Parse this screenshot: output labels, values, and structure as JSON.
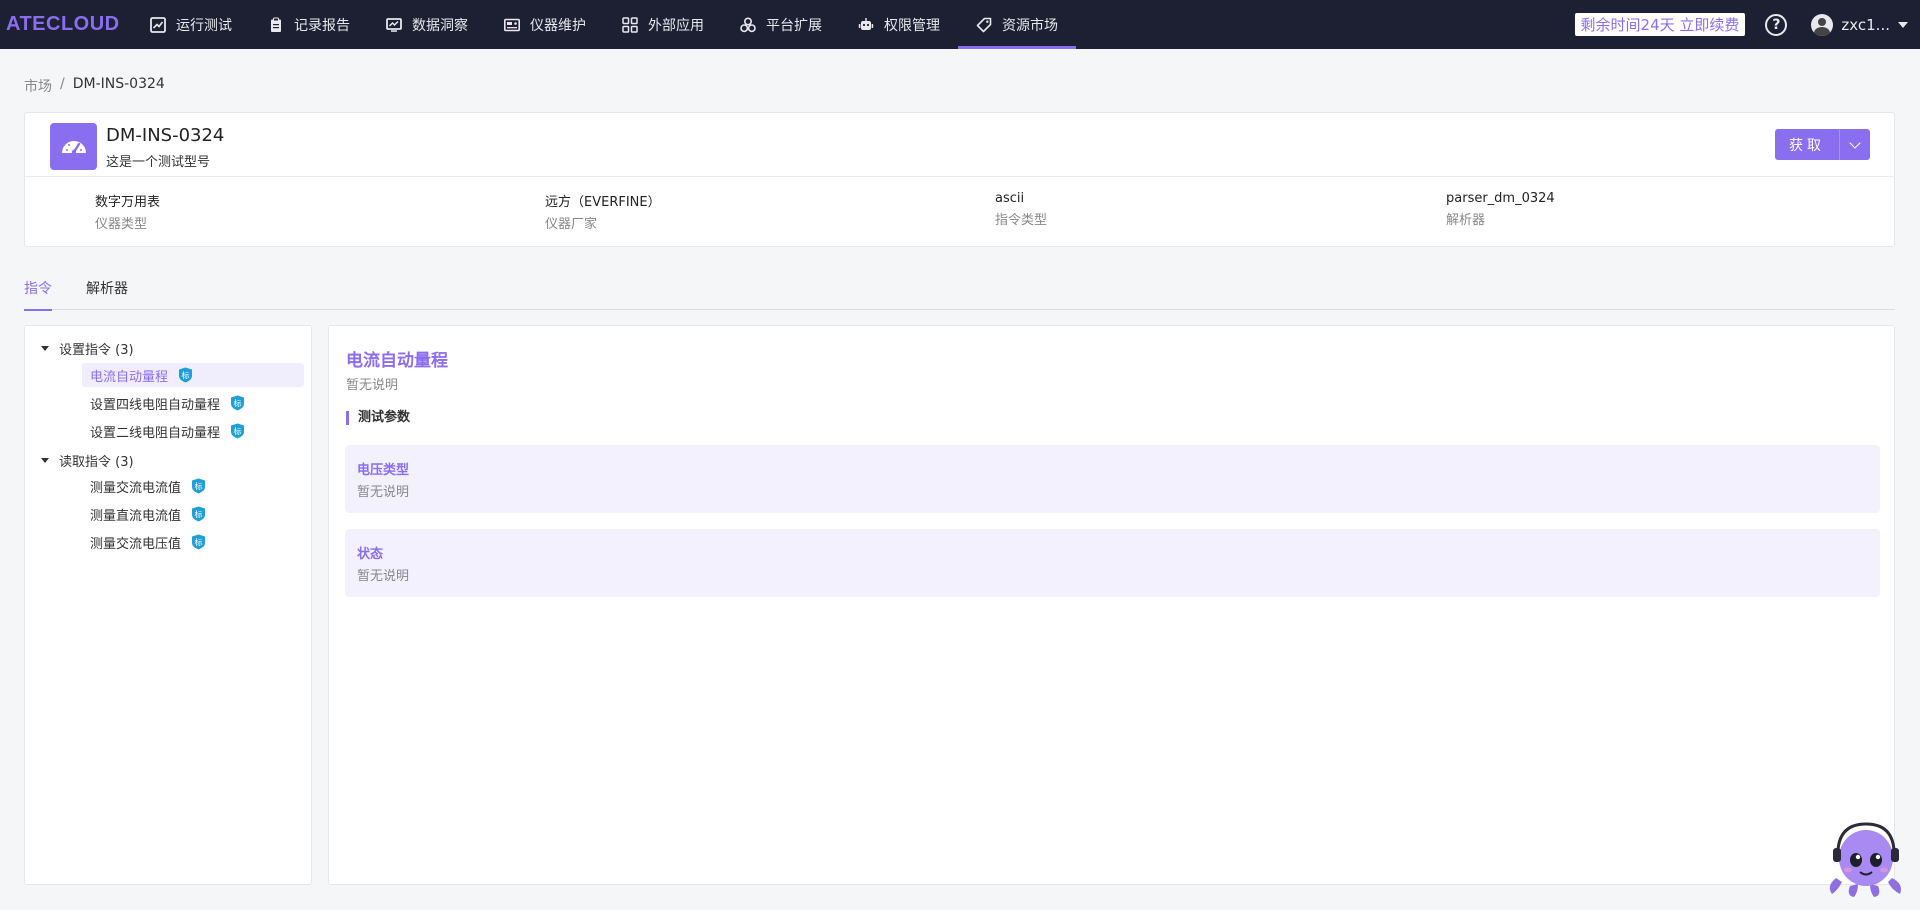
{
  "brand": {
    "logo": "ATECLOUD",
    "accent": "#8a6ef0",
    "nav_bg": "#1d1f33"
  },
  "nav": [
    {
      "label": "运行测试",
      "icon": "chart-line-icon"
    },
    {
      "label": "记录报告",
      "icon": "clipboard-icon"
    },
    {
      "label": "数据洞察",
      "icon": "monitor-icon"
    },
    {
      "label": "仪器维护",
      "icon": "instrument-icon"
    },
    {
      "label": "外部应用",
      "icon": "grid-apps-icon"
    },
    {
      "label": "平台扩展",
      "icon": "cluster-icon"
    },
    {
      "label": "权限管理",
      "icon": "robot-icon"
    },
    {
      "label": "资源市场",
      "icon": "tag-icon",
      "active": true
    }
  ],
  "topright": {
    "renew": "剩余时间24天 立即续费",
    "help": "?",
    "user": "zxc1..."
  },
  "breadcrumb": {
    "root": "市场",
    "sep": "/",
    "current": "DM-INS-0324"
  },
  "instrument": {
    "name": "DM-INS-0324",
    "subtitle": "这是一个测试型号",
    "get_button": "获取",
    "fields": [
      {
        "value": "数字万用表",
        "key": "仪器类型"
      },
      {
        "value": "远方（EVERFINE）",
        "key": "仪器厂家"
      },
      {
        "value": "ascii",
        "key": "指令类型"
      },
      {
        "value": "parser_dm_0324",
        "key": "解析器"
      }
    ]
  },
  "tabs": [
    {
      "label": "指令",
      "active": true
    },
    {
      "label": "解析器"
    }
  ],
  "tree": {
    "groups": [
      {
        "label": "设置指令 (3)",
        "items": [
          "电流自动量程",
          "设置四线电阻自动量程",
          "设置二线电阻自动量程"
        ]
      },
      {
        "label": "读取指令 (3)",
        "items": [
          "测量交流电流值",
          "测量直流电流值",
          "测量交流电压值"
        ]
      }
    ],
    "badge_text": "标",
    "badge_color": "#1e9fd8"
  },
  "detail": {
    "title": "电流自动量程",
    "desc": "暂无说明",
    "section": "测试参数",
    "params": [
      {
        "name": "电压类型",
        "desc": "暂无说明"
      },
      {
        "name": "状态",
        "desc": "暂无说明"
      }
    ]
  }
}
